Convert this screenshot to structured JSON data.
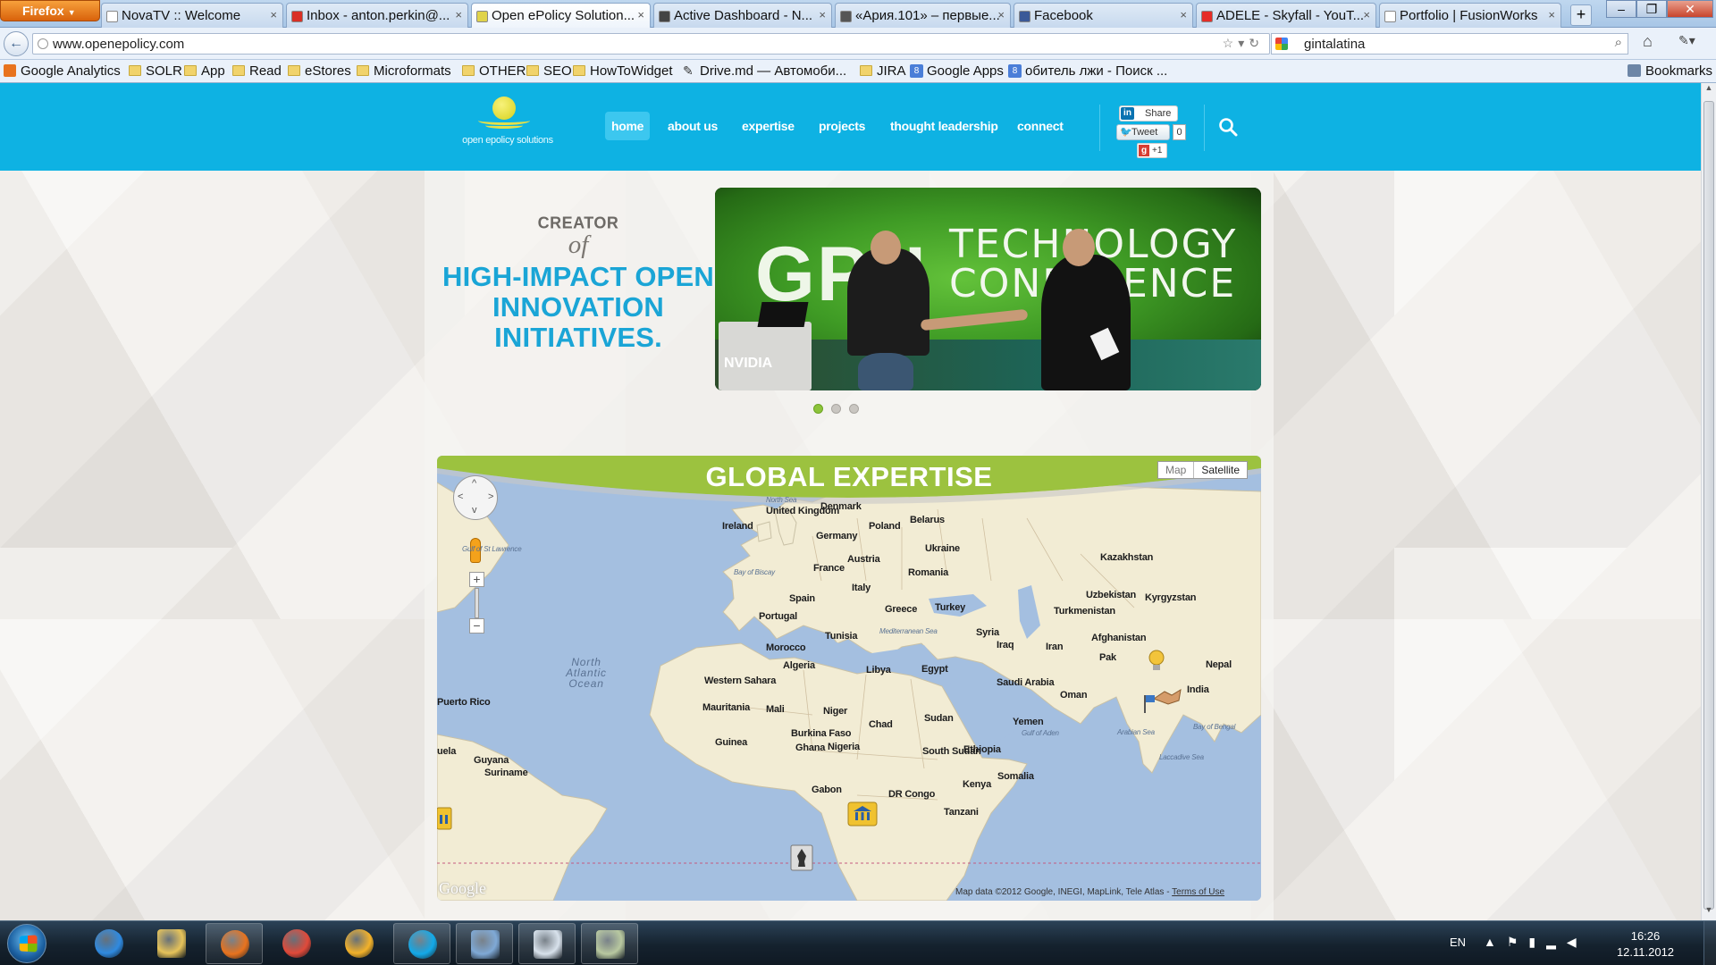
{
  "browser": {
    "menu_button": "Firefox",
    "tabs": [
      {
        "title": "NovaTV :: Welcome",
        "icon": "page-icon",
        "color": "#ffffff"
      },
      {
        "title": "Inbox - anton.perkin@...",
        "icon": "gmail-icon",
        "color": "#d93025"
      },
      {
        "title": "Open ePolicy Solution...",
        "icon": "epolicy-icon",
        "color": "#e0d34a",
        "active": true
      },
      {
        "title": "Active Dashboard - N...",
        "icon": "dashboard-icon",
        "color": "#444444"
      },
      {
        "title": "«Ария.101» – первые...",
        "icon": "play-icon",
        "color": "#555555"
      },
      {
        "title": "Facebook",
        "icon": "facebook-icon",
        "color": "#3b5998"
      },
      {
        "title": "ADELE - Skyfall - YouT...",
        "icon": "youtube-icon",
        "color": "#e52d27"
      },
      {
        "title": "Portfolio | FusionWorks",
        "icon": "page-icon",
        "color": "#ffffff"
      }
    ],
    "close_glyph": "×",
    "new_tab_glyph": "+",
    "url": "www.openepolicy.com",
    "search_value": "gintalatina",
    "bookmarks": [
      {
        "label": "Google Analytics",
        "icon": "analytics-icon"
      },
      {
        "label": "SOLR",
        "icon": "folder-icon"
      },
      {
        "label": "App",
        "icon": "folder-icon"
      },
      {
        "label": "Read",
        "icon": "folder-icon"
      },
      {
        "label": "eStores",
        "icon": "folder-icon"
      },
      {
        "label": "Microformats",
        "icon": "folder-icon"
      },
      {
        "label": "OTHER",
        "icon": "folder-icon"
      },
      {
        "label": "SEO",
        "icon": "folder-icon"
      },
      {
        "label": "HowToWidget",
        "icon": "folder-icon"
      },
      {
        "label": "Drive.md — Автомоби...",
        "icon": "drive-icon"
      },
      {
        "label": "JIRA",
        "icon": "folder-icon"
      },
      {
        "label": "Google Apps",
        "icon": "google-apps-icon"
      },
      {
        "label": "обитель лжи - Поиск ...",
        "icon": "google-apps-icon"
      }
    ],
    "bookmarks_menu": "Bookmarks"
  },
  "site": {
    "logo_text": "open epolicy solutions",
    "nav": [
      {
        "label": "home",
        "current": true
      },
      {
        "label": "about us"
      },
      {
        "label": "expertise"
      },
      {
        "label": "projects"
      },
      {
        "label": "thought leadership"
      },
      {
        "label": "connect"
      }
    ],
    "share": {
      "linkedin": "Share",
      "tweet": "Tweet",
      "tweet_count": "0",
      "gplus": "+1"
    },
    "tagline": {
      "creator": "CREATOR",
      "of": "of",
      "headline": "HIGH-IMPACT OPEN INNOVATION INITIATIVES."
    },
    "slide": {
      "gpu_text": "GPU",
      "tech_text_1": "TECHNOLOGY",
      "tech_text_2": "CONFERENCE",
      "brand": "NVIDIA"
    },
    "slider_count": 3,
    "slider_active": 0,
    "map": {
      "title": "GLOBAL EXPERTISE",
      "type_map": "Map",
      "type_satellite": "Satellite",
      "zoom_in": "+",
      "zoom_out": "−",
      "ocean": "North Atlantic Ocean",
      "attribution": "Map data ©2012 Google, INEGI, MapLink, Tele Atlas - ",
      "terms": "Terms of Use",
      "google": "Google",
      "countries": [
        {
          "name": "United Kingdom"
        },
        {
          "name": "Ireland"
        },
        {
          "name": "Denmark"
        },
        {
          "name": "Poland"
        },
        {
          "name": "Belarus"
        },
        {
          "name": "Germany"
        },
        {
          "name": "Ukraine"
        },
        {
          "name": "Austria"
        },
        {
          "name": "France"
        },
        {
          "name": "Romania"
        },
        {
          "name": "Italy"
        },
        {
          "name": "Spain"
        },
        {
          "name": "Portugal"
        },
        {
          "name": "Greece"
        },
        {
          "name": "Turkey"
        },
        {
          "name": "Kazakhstan"
        },
        {
          "name": "Uzbekistan"
        },
        {
          "name": "Kyrgyzstan"
        },
        {
          "name": "Turkmenistan"
        },
        {
          "name": "Syria"
        },
        {
          "name": "Iraq"
        },
        {
          "name": "Iran"
        },
        {
          "name": "Afghanistan"
        },
        {
          "name": "Pak"
        },
        {
          "name": "Nepal"
        },
        {
          "name": "India"
        },
        {
          "name": "Tunisia"
        },
        {
          "name": "Morocco"
        },
        {
          "name": "Algeria"
        },
        {
          "name": "Libya"
        },
        {
          "name": "Egypt"
        },
        {
          "name": "Saudi Arabia"
        },
        {
          "name": "Oman"
        },
        {
          "name": "Yemen"
        },
        {
          "name": "Western Sahara"
        },
        {
          "name": "Mauritania"
        },
        {
          "name": "Mali"
        },
        {
          "name": "Niger"
        },
        {
          "name": "Chad"
        },
        {
          "name": "Sudan"
        },
        {
          "name": "Burkina Faso"
        },
        {
          "name": "Ghana"
        },
        {
          "name": "Guinea"
        },
        {
          "name": "Nigeria"
        },
        {
          "name": "South Sudan"
        },
        {
          "name": "Ethiopia"
        },
        {
          "name": "Somalia"
        },
        {
          "name": "Kenya"
        },
        {
          "name": "Gabon"
        },
        {
          "name": "DR Congo"
        },
        {
          "name": "Tanzani"
        },
        {
          "name": "Guyana"
        },
        {
          "name": "Suriname"
        },
        {
          "name": "uela"
        },
        {
          "name": "Puerto Rico"
        }
      ],
      "seas": [
        {
          "name": "North Sea"
        },
        {
          "name": "Bay of Biscay"
        },
        {
          "name": "Mediterranean Sea"
        },
        {
          "name": "Arabian Sea"
        },
        {
          "name": "Bay of Bengal"
        },
        {
          "name": "Laccadive Sea"
        },
        {
          "name": "Gulf of Aden"
        },
        {
          "name": "Gulf of St Lawrence"
        }
      ]
    }
  },
  "taskbar": {
    "apps": [
      {
        "name": "internet-explorer-icon",
        "color": "#2f8ae0"
      },
      {
        "name": "file-explorer-icon",
        "color": "#e6c35a"
      },
      {
        "name": "firefox-icon",
        "color": "#e8731e",
        "open": true
      },
      {
        "name": "chrome-icon",
        "color": "#e04a3a"
      },
      {
        "name": "winamp-icon",
        "color": "#f3b22a"
      },
      {
        "name": "skype-icon",
        "color": "#13a9e8",
        "open": true
      },
      {
        "name": "network-tool-icon",
        "color": "#7fa9d6",
        "open": true
      },
      {
        "name": "document-viewer-icon",
        "color": "#d8e2ec",
        "open": true
      },
      {
        "name": "tools-icon",
        "color": "#b8c8a0",
        "open": true
      }
    ],
    "language": "EN",
    "time": "16:26",
    "date": "12.11.2012"
  }
}
